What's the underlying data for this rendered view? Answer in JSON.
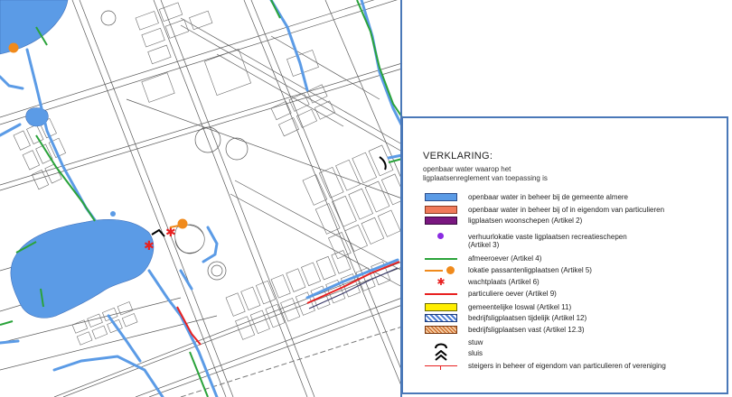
{
  "legend": {
    "title": "VERKLARING:",
    "subtitle_line1": "openbaar water waarop het",
    "subtitle_line2": "ligplaatsenreglement van toepassing is",
    "items": [
      {
        "label": "openbaar water in beheer bij de gemeente almere",
        "color": "#5b9be6",
        "symbol": "fill-box"
      },
      {
        "label": "openbaar water in beheer bij of in eigendom van particulieren",
        "color": "#f07a5a",
        "symbol": "fill-box"
      },
      {
        "label": "ligplaatsen woonschepen (Artikel 2)",
        "color": "#7a1780",
        "symbol": "fill-box"
      },
      {
        "label": "verhuurlokatie vaste ligplaatsen recreatieschepen",
        "label_line2": "(Artikel 3)",
        "color": "#8a2be2",
        "symbol": "dot"
      },
      {
        "label": "afmeeroever (Artikel 4)",
        "color": "#2aa33a",
        "symbol": "line"
      },
      {
        "label": "lokatie passantenligplaatsen (Artikel 5)",
        "color": "#f08a1c",
        "symbol": "line-dot"
      },
      {
        "label": "wachtplaats (Artikel 6)",
        "color": "#e82020",
        "symbol": "asterisk"
      },
      {
        "label": "particuliere oever (Artikel 9)",
        "color": "#e82020",
        "symbol": "line"
      },
      {
        "label": "gemeentelijke loswal (Artikel 11)",
        "color": "#ffee00",
        "symbol": "fill-box"
      },
      {
        "label": "bedrijfsligplaatsen tijdelijk (Artikel 12)",
        "color": "#4a7bd4",
        "symbol": "hatch-blue"
      },
      {
        "label": "bedrijfsligplaatsen vast (Artikel 12.3)",
        "color": "#e07a20",
        "symbol": "hatch-orange"
      },
      {
        "label": "stuw",
        "color": "#000000",
        "symbol": "stuw-icon"
      },
      {
        "label": "sluis",
        "color": "#000000",
        "symbol": "sluis-icon"
      },
      {
        "label": "steigers in beheer of eigendom van particulieren of vereniging",
        "color": "#e82020",
        "symbol": "steiger-icon"
      }
    ]
  },
  "colors": {
    "water": "#5b9be6",
    "green_bank": "#2aa33a",
    "red_bank": "#e82020",
    "orange_dot": "#f08a1c",
    "purple_dot": "#8a2be2",
    "frame": "#4a78b8",
    "streets": "#555555"
  }
}
